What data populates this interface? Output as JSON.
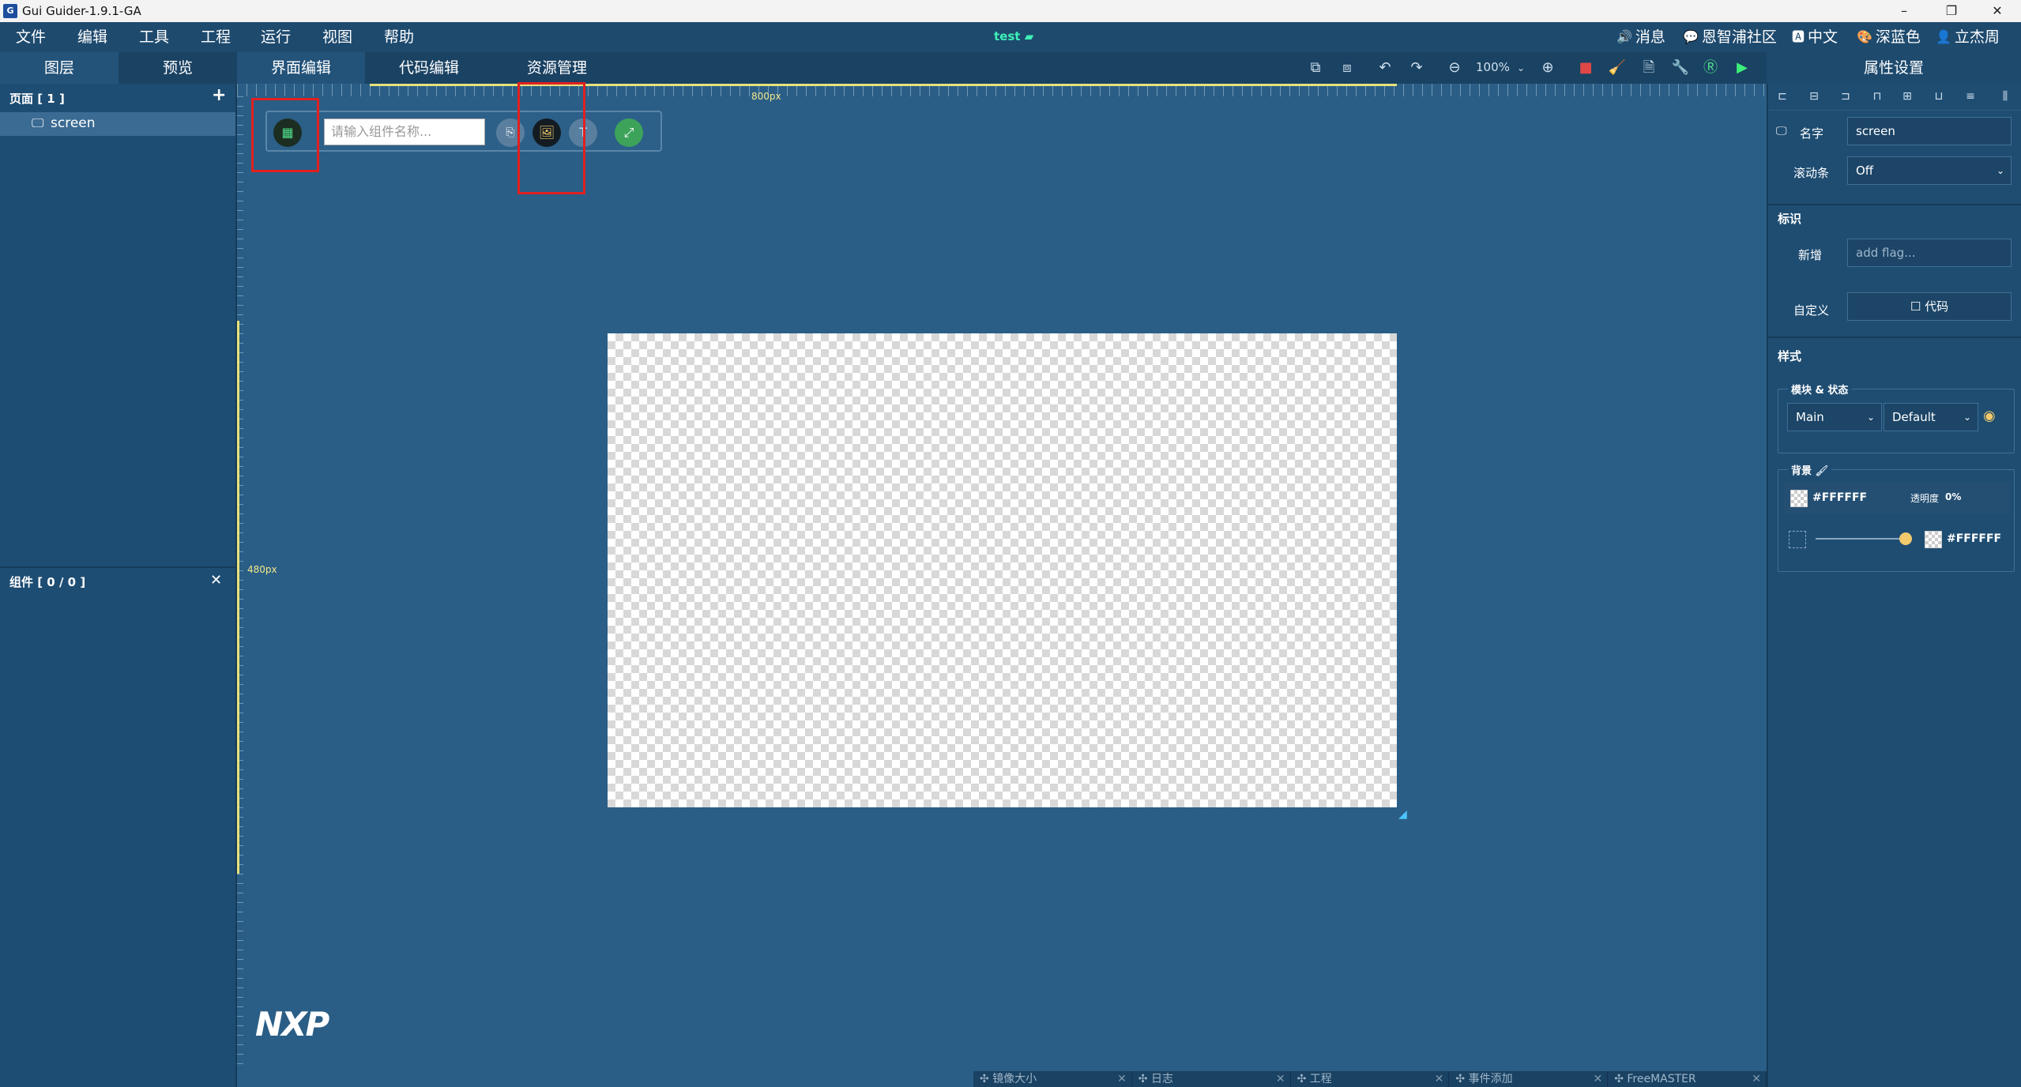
{
  "window": {
    "title": "Gui Guider-1.9.1-GA",
    "app_icon_glyph": "G",
    "controls": {
      "minimize": "–",
      "restore": "❐",
      "close": "✕"
    }
  },
  "menu": {
    "items": [
      "文件",
      "编辑",
      "工具",
      "工程",
      "运行",
      "视图",
      "帮助"
    ],
    "project_name": "test",
    "right": [
      {
        "icon": "speaker-icon",
        "glyph": "🔊",
        "label": "消息"
      },
      {
        "icon": "chat-icon",
        "glyph": "💬",
        "label": "恩智浦社区"
      },
      {
        "icon": "language-icon",
        "glyph": "🅰",
        "label": "中文"
      },
      {
        "icon": "palette-icon",
        "glyph": "🎨",
        "label": "深蓝色"
      },
      {
        "icon": "user-icon",
        "glyph": "👤",
        "label": "立杰周"
      }
    ]
  },
  "tabs": {
    "left": [
      "图层",
      "预览"
    ],
    "editor": [
      "界面编辑",
      "代码编辑",
      "资源管理"
    ],
    "zoom": "100%",
    "properties_title": "属性设置"
  },
  "left_panel": {
    "pages_header": "页面 [ 1 ]",
    "add_glyph": "+",
    "screen_item": "screen",
    "widgets_header": "组件 [ 0 / 0 ]",
    "collapse_glyph": "✕"
  },
  "canvas": {
    "ruler_width_label": "800px",
    "ruler_height_label": "480px",
    "search_placeholder": "请输入组件名称...",
    "logo_text": "NXP"
  },
  "bottom_tabs": [
    "镜像大小",
    "日志",
    "工程",
    "事件添加",
    "FreeMASTER"
  ],
  "properties": {
    "name_label": "名字",
    "name_value": "screen",
    "scrollbar_label": "滚动条",
    "scrollbar_value": "Off",
    "flags_section": "标识",
    "add_label": "新增",
    "add_placeholder": "add flag...",
    "custom_label": "自定义",
    "code_button": "☐ 代码",
    "style_section": "样式",
    "module_state_legend": "模块 & 状态",
    "module_value": "Main",
    "state_value": "Default",
    "background_legend": "背景",
    "bg_color": "#FFFFFF",
    "opacity_label": "透明度",
    "opacity_value": "0%",
    "gradient_color": "#FFFFFF"
  },
  "colors": {
    "accent": "#3df0b7",
    "highlight_box": "#e02020",
    "canvas_bg": "#2a5e86"
  }
}
